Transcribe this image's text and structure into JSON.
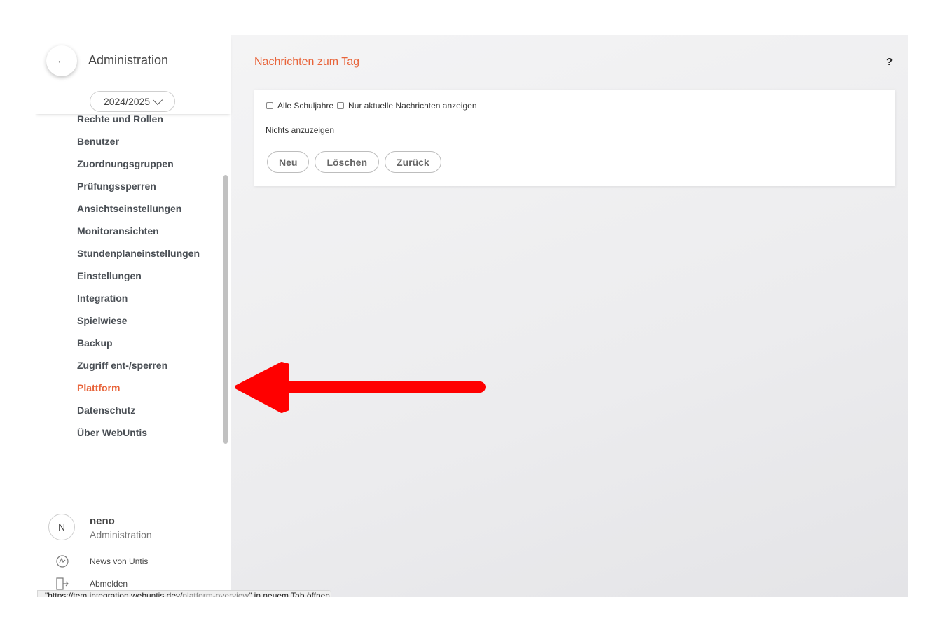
{
  "sidebar": {
    "back_icon": "arrow-left-icon",
    "title": "Administration",
    "year": "2024/2025",
    "items": [
      {
        "label": "Rechte und Rollen"
      },
      {
        "label": "Benutzer"
      },
      {
        "label": "Zuordnungsgruppen"
      },
      {
        "label": "Prüfungssperren"
      },
      {
        "label": "Ansichtseinstellungen"
      },
      {
        "label": "Monitoransichten"
      },
      {
        "label": "Stundenplaneinstellungen"
      },
      {
        "label": "Einstellungen"
      },
      {
        "label": "Integration"
      },
      {
        "label": "Spielwiese"
      },
      {
        "label": "Backup"
      },
      {
        "label": "Zugriff ent-/sperren"
      },
      {
        "label": "Plattform",
        "active": true
      },
      {
        "label": "Datenschutz"
      },
      {
        "label": "Über WebUntis"
      }
    ],
    "user": {
      "initial": "N",
      "name": "neno",
      "role": "Administration"
    },
    "news_label": "News von Untis",
    "logout_label": "Abmelden"
  },
  "statusbar": {
    "prefix": "\"https://tem.integration.webuntis.dev/",
    "path": "platform-overview",
    "suffix": "\" in neuem Tab öffnen"
  },
  "main": {
    "title": "Nachrichten zum Tag",
    "help": "?",
    "filters": {
      "all_years": "Alle Schuljahre",
      "current_only": "Nur aktuelle Nachrichten anzeigen"
    },
    "empty_text": "Nichts anzuzeigen",
    "buttons": {
      "new": "Neu",
      "delete": "Löschen",
      "back": "Zurück"
    }
  },
  "colors": {
    "accent": "#e8643a",
    "active_bg": "#fbeae4",
    "annotation_arrow": "#ff0000"
  }
}
